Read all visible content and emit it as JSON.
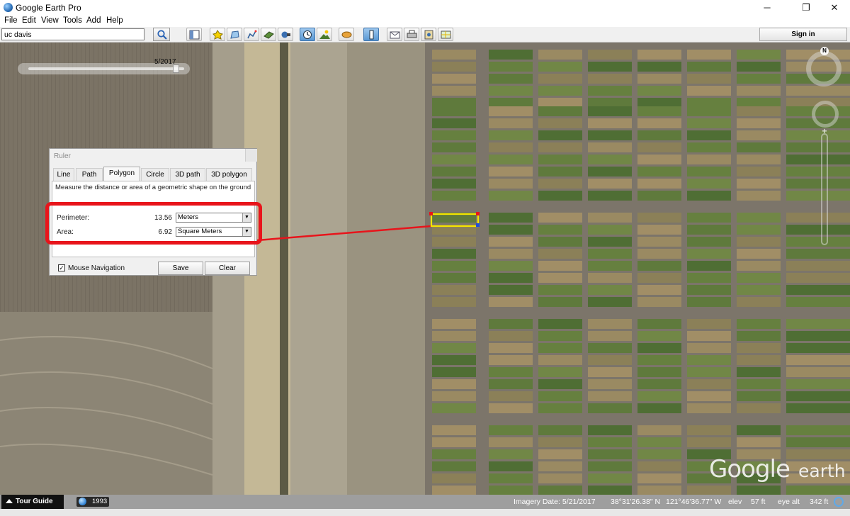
{
  "window": {
    "title": "Google Earth Pro",
    "minimize": "─",
    "maximize": "❐",
    "close": "✕"
  },
  "menu": [
    "File",
    "Edit",
    "View",
    "Tools",
    "Add",
    "Help"
  ],
  "toolbar": {
    "search_value": "uc davis",
    "buttons": [
      "sidebar-toggle-icon",
      "placemark-icon",
      "polygon-icon",
      "path-icon",
      "image-overlay-icon",
      "record-tour-icon",
      "historical-imagery-icon",
      "sunlight-icon",
      "planets-icon",
      "ruler-icon",
      "email-icon",
      "print-icon",
      "save-image-icon",
      "view-in-maps-icon"
    ],
    "active_buttons": [
      "historical-imagery-icon",
      "ruler-icon"
    ],
    "sign_in": "Sign in"
  },
  "time_slider": {
    "date": "5/2017"
  },
  "compass": {
    "north": "N"
  },
  "ruler": {
    "title": "Ruler",
    "tabs": [
      "Line",
      "Path",
      "Polygon",
      "Circle",
      "3D path",
      "3D polygon"
    ],
    "active_tab": "Polygon",
    "description": "Measure the distance or area of a geometric shape on the ground",
    "perimeter": {
      "label": "Perimeter:",
      "value": "13.56",
      "unit": "Meters"
    },
    "area": {
      "label": "Area:",
      "value": "6.92",
      "unit": "Square Meters"
    },
    "mouse_navigation": {
      "label": "Mouse Navigation",
      "checked": true
    },
    "save": "Save",
    "clear": "Clear"
  },
  "logo": {
    "google": "Google",
    "earth": "earth"
  },
  "status": {
    "tour_guide": "Tour Guide",
    "history_year": "1993",
    "imagery_date": "Imagery Date: 5/21/2017",
    "lat": "38°31'26.38\" N",
    "lon": "121°46'36.77\" W",
    "elev_label": "elev",
    "elev": "57 ft",
    "eye_label": "eye alt",
    "eye_alt": "342 ft"
  },
  "colors": {
    "highlight": "#e8141b",
    "polygon_outline": "#f5e400",
    "measure_line": "#e8141b"
  }
}
